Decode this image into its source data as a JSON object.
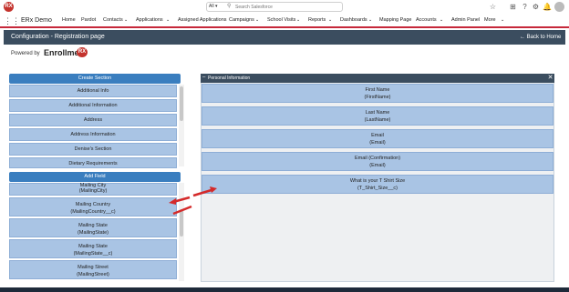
{
  "header": {
    "search_scope": "All",
    "search_placeholder": "Search Salesforce"
  },
  "nav": {
    "app_name": "ERx Demo",
    "items": [
      "Home",
      "Pardot",
      "Contacts",
      "Applications",
      "Assigned Applications",
      "Campaigns",
      "School Visits",
      "Reports",
      "Dashboards",
      "Mapping Page",
      "Accounts",
      "Admin Panel",
      "More"
    ]
  },
  "page": {
    "title": "Configuration - Registration page",
    "back_link": "← Back to Home",
    "powered_by": "Powered by",
    "brand": "Enrollment",
    "brand_badge": "RX"
  },
  "sections_panel": {
    "header": "Create Section",
    "items": [
      "Additional Info",
      "Additional Information",
      "Address",
      "Address Information",
      "Denise's Section",
      "Dietary Requirements"
    ]
  },
  "fields_panel": {
    "header": "Add Field",
    "items": [
      {
        "label": "Mailing City",
        "api": "(MailingCity)"
      },
      {
        "label": "Mailing Country",
        "api": "(MailingCountry__c)"
      },
      {
        "label": "Mailing State",
        "api": "(MailingState)"
      },
      {
        "label": "Mailing State",
        "api": "(MailingState__c)"
      },
      {
        "label": "Mailing Street",
        "api": "(MailingStreet)"
      }
    ]
  },
  "section_editor": {
    "title": "Personal Information",
    "fields": [
      {
        "label": "First Name",
        "api": "(FirstName)"
      },
      {
        "label": "Last Name",
        "api": "(LastName)"
      },
      {
        "label": "Email",
        "api": "(Email)"
      },
      {
        "label": "Email (Confirmation)",
        "api": "(Email)"
      },
      {
        "label": "What is your T Shirt Size",
        "api": "(T_Shirt_Size__c)"
      }
    ]
  },
  "colors": {
    "header_dark": "#3b4d5f",
    "button_blue": "#3a7ebf",
    "item_blue": "#a9c4e4",
    "arrow_red": "#d42a2a",
    "nav_accent": "#c6283a"
  },
  "icons": [
    "app-launcher-icon",
    "search-icon",
    "favorites-icon",
    "add-icon",
    "help-icon",
    "settings-icon",
    "notifications-icon",
    "chevron-down-icon",
    "close-icon",
    "minus-icon"
  ]
}
